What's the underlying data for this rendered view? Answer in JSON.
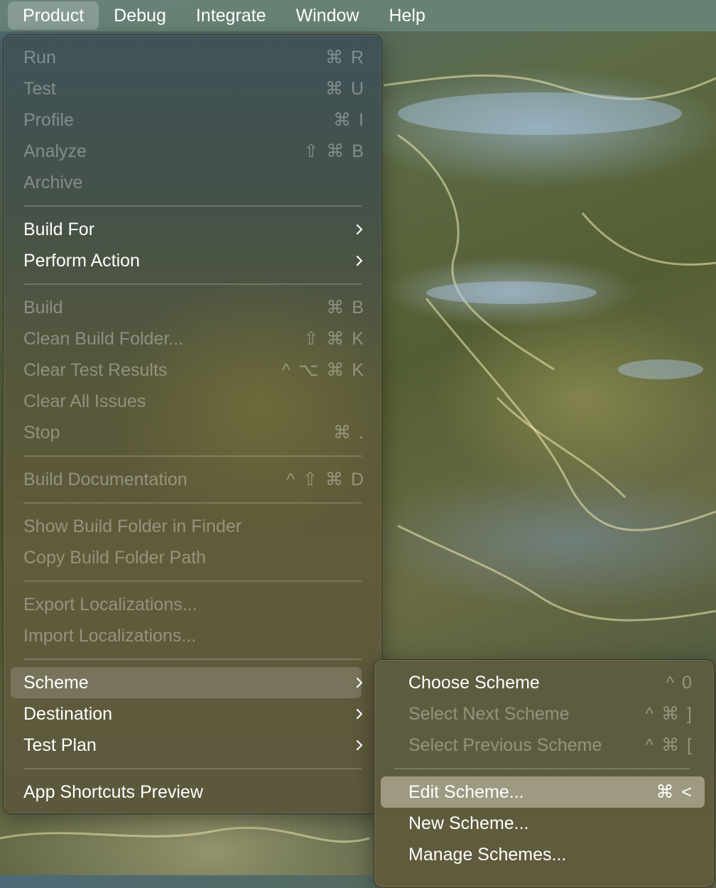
{
  "menubar": {
    "items": [
      {
        "label": "Product",
        "active": true
      },
      {
        "label": "Debug"
      },
      {
        "label": "Integrate"
      },
      {
        "label": "Window"
      },
      {
        "label": "Help"
      }
    ]
  },
  "product_menu": {
    "items": [
      {
        "label": "Run",
        "shortcut": "⌘ R",
        "enabled": false
      },
      {
        "label": "Test",
        "shortcut": "⌘ U",
        "enabled": false
      },
      {
        "label": "Profile",
        "shortcut": "⌘ I",
        "enabled": false
      },
      {
        "label": "Analyze",
        "shortcut": "⇧ ⌘ B",
        "enabled": false
      },
      {
        "label": "Archive",
        "shortcut": "",
        "enabled": false
      },
      {
        "label": "Build For",
        "submenu": true,
        "enabled": true
      },
      {
        "label": "Perform Action",
        "submenu": true,
        "enabled": true
      },
      {
        "label": "Build",
        "shortcut": "⌘ B",
        "enabled": false
      },
      {
        "label": "Clean Build Folder...",
        "shortcut": "⇧ ⌘ K",
        "enabled": false
      },
      {
        "label": "Clear Test Results",
        "shortcut": "^ ⌥ ⌘ K",
        "enabled": false
      },
      {
        "label": "Clear All Issues",
        "shortcut": "",
        "enabled": false
      },
      {
        "label": "Stop",
        "shortcut": "⌘ .",
        "enabled": false
      },
      {
        "label": "Build Documentation",
        "shortcut": "^ ⇧ ⌘ D",
        "enabled": false
      },
      {
        "label": "Show Build Folder in Finder",
        "shortcut": "",
        "enabled": false
      },
      {
        "label": "Copy Build Folder Path",
        "shortcut": "",
        "enabled": false
      },
      {
        "label": "Export Localizations...",
        "shortcut": "",
        "enabled": false
      },
      {
        "label": "Import Localizations...",
        "shortcut": "",
        "enabled": false
      },
      {
        "label": "Scheme",
        "submenu": true,
        "enabled": true,
        "highlighted": true
      },
      {
        "label": "Destination",
        "submenu": true,
        "enabled": true
      },
      {
        "label": "Test Plan",
        "submenu": true,
        "enabled": true
      },
      {
        "label": "App Shortcuts Preview",
        "shortcut": "",
        "enabled": true
      }
    ]
  },
  "scheme_submenu": {
    "items": [
      {
        "label": "Choose Scheme",
        "shortcut": "^ 0",
        "enabled": true
      },
      {
        "label": "Select Next Scheme",
        "shortcut": "^ ⌘ ]",
        "enabled": false
      },
      {
        "label": "Select Previous Scheme",
        "shortcut": "^ ⌘ [",
        "enabled": false
      },
      {
        "label": "Edit Scheme...",
        "shortcut": "⌘ <",
        "enabled": true,
        "selected": true
      },
      {
        "label": "New Scheme...",
        "shortcut": "",
        "enabled": true
      },
      {
        "label": "Manage Schemes...",
        "shortcut": "",
        "enabled": true
      }
    ]
  }
}
